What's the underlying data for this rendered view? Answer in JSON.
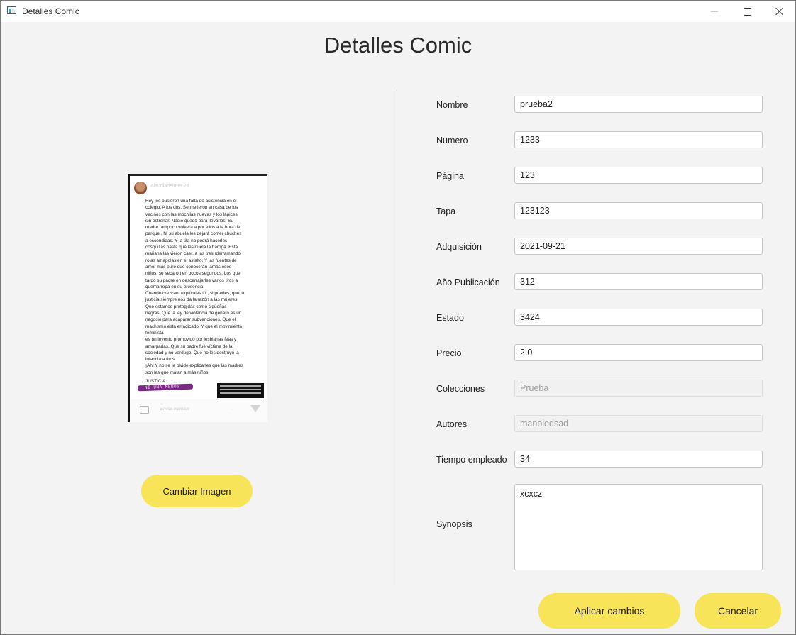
{
  "window": {
    "title": "Detalles Comic"
  },
  "page": {
    "title": "Detalles Comic"
  },
  "cover": {
    "username": "claudiadelmer  29",
    "text_lines": [
      "Hoy les pusieron una falta de asistencia en el",
      "colegio. A los dos. Se metieron en casa de los",
      "vecinos con las mochilas nuevas y los lápices",
      "sin estrenar. Nadie quedó para llevarlos. Su",
      "madre tampoco volverá a por ellos a la hora del",
      "parque . Ni su abuela les dejará comer chuches",
      "a escondidas. Y la tita no podrá hacerles",
      "cosquillas hasta que les duela la barriga. Esta",
      "mañana las vieron caer, a las tres ¡derramando",
      "rojas amapolas en el asfalto. Y las fuentes de",
      "amor más puro que conocerán jamás esos",
      "niños, se secaron en pocos segundos. Los que",
      "tardó su padre en descerrajarles varios tiros a",
      "quemarropa en su presencia.",
      "Cuando crezcan, explícales tú , si puedes, que la",
      "justicia siempre nos da la razón a las mujeres.",
      "Que estamos protegidas como cigüeñas",
      "negras. Que la ley de violencia de género es un",
      "negocio para acaparar subvenciones. Que el",
      "machismo está erradicado. Y que el movimiento",
      "feminista",
      "es un invento promovido por lesbianas feas y",
      "amargadas. Que su padre fue víctima de la",
      "sociedad y no verdugo. Que no les destruyó la",
      "infancia a tiros.",
      "¡Ah! Y no se te olvide explicarles que las madres",
      "son las que matan a más niños."
    ],
    "justicia": "JUSTICIA",
    "banner": "NI UNA MENOS",
    "reply_placeholder": "Enviar mensaje"
  },
  "buttons": {
    "change_image": "Cambiar Imagen",
    "apply": "Aplicar cambios",
    "cancel": "Cancelar"
  },
  "form": {
    "nombre": {
      "label": "Nombre",
      "value": "prueba2"
    },
    "numero": {
      "label": "Numero",
      "value": "1233"
    },
    "pagina": {
      "label": "Página",
      "value": "123"
    },
    "tapa": {
      "label": "Tapa",
      "value": "123123"
    },
    "adquisicion": {
      "label": "Adquisición",
      "value": "2021-09-21"
    },
    "anio": {
      "label": "Año Publicación",
      "value": "312"
    },
    "estado": {
      "label": "Estado",
      "value": "3424"
    },
    "precio": {
      "label": "Precio",
      "value": "2.0"
    },
    "colecciones": {
      "label": "Colecciones",
      "value": "Prueba"
    },
    "autores": {
      "label": "Autores",
      "value": "manolodsad"
    },
    "tiempo": {
      "label": "Tiempo empleado",
      "value": "34"
    },
    "synopsis": {
      "label": "Synopsis",
      "value": "xcxcz"
    }
  },
  "colors": {
    "accent": "#f8e459",
    "background": "#f3f3f3"
  },
  "icons": {
    "app": "app-window-icon",
    "minimize": "minimize-icon",
    "maximize": "maximize-icon",
    "close": "close-icon"
  }
}
